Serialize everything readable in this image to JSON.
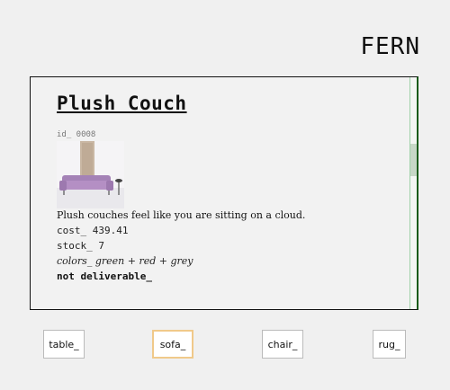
{
  "brand": "FERN",
  "product": {
    "title": "Plush Couch",
    "id_label": "id_ 0008",
    "description": "Plush couches feel like you are sitting on a cloud.",
    "cost_label": "cost_ 439.41",
    "stock_label": "stock_ 7",
    "colors_label": "colors_ green + red + grey",
    "delivery_label": "not deliverable_",
    "image_subject": "purple-couch-photo"
  },
  "nav": {
    "items": [
      {
        "label": "table_",
        "active": false
      },
      {
        "label": "sofa_",
        "active": true
      },
      {
        "label": "chair_",
        "active": false
      },
      {
        "label": "rug_",
        "active": false
      }
    ]
  },
  "colors": {
    "card_border_right": "#1a5c1a",
    "active_button_border": "#f0c98a",
    "couch": "#b48fc4"
  }
}
